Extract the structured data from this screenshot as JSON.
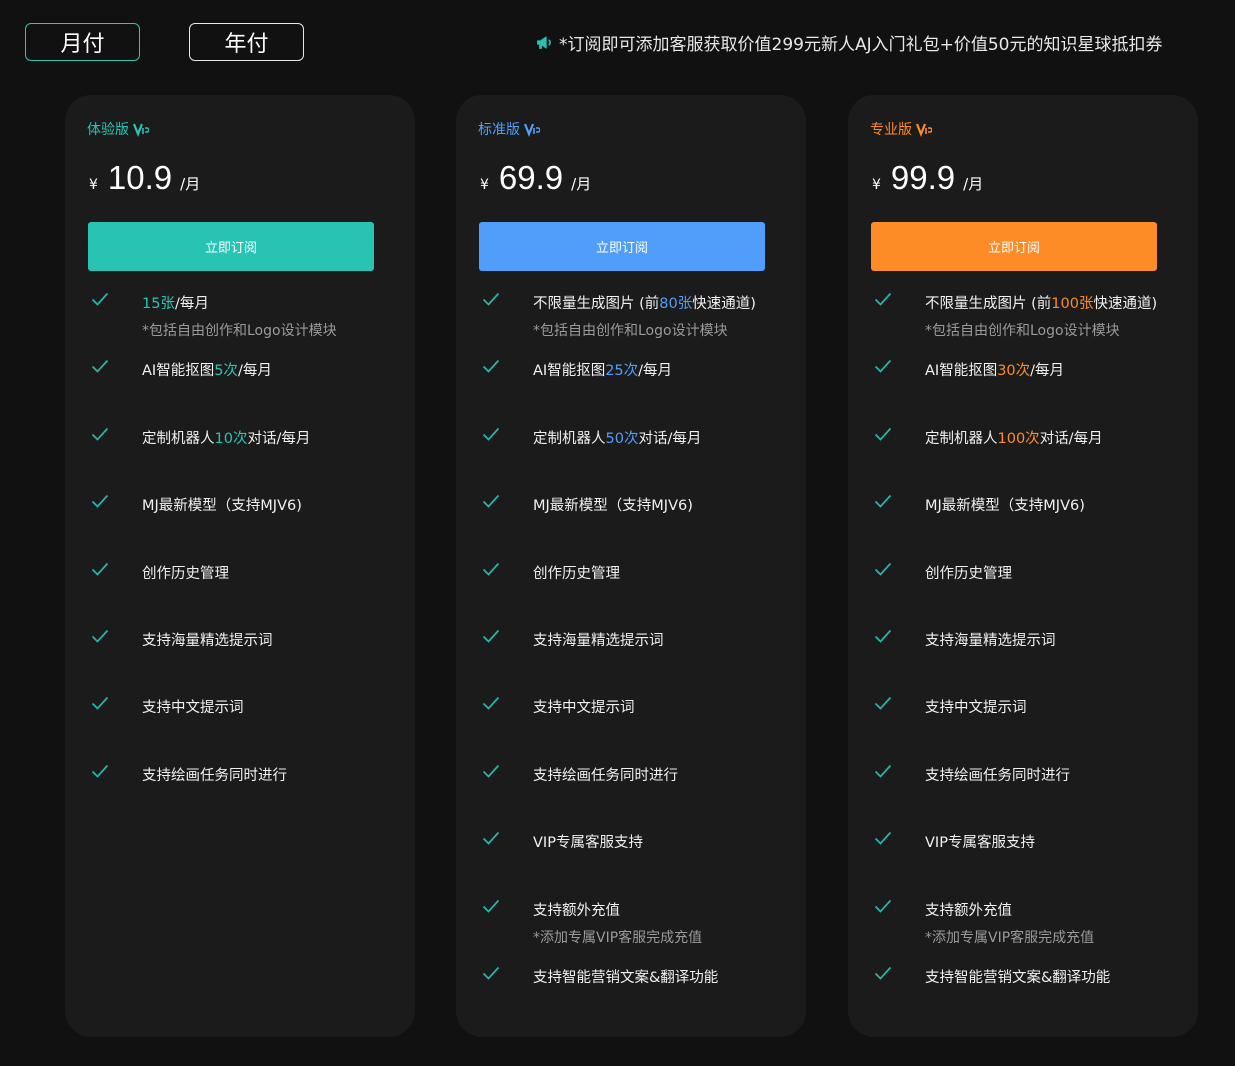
{
  "tabs": {
    "monthly": "月付",
    "yearly": "年付"
  },
  "notice": {
    "icon": "megaphone-icon",
    "text": "*订阅即可添加客服获取价值299元新人AJ入门礼包+价值50元的知识星球抵扣券"
  },
  "colors": {
    "trial": "#28c4b3",
    "standard": "#509ef9",
    "pro": "#fd8b26",
    "check": "#28b4a8"
  },
  "plans": [
    {
      "tier": "体验版",
      "currency": "¥",
      "price": "10.9",
      "per": "/月",
      "button": "立即订阅",
      "features": [
        {
          "pre": "",
          "hl": "15张",
          "post": "/每月",
          "note": "*包括自由创作和Logo设计模块"
        },
        {
          "pre": "AI智能抠图",
          "hl": "5次",
          "post": "/每月"
        },
        {
          "pre": "定制机器人",
          "hl": "10次",
          "post": "对话/每月"
        },
        {
          "pre": "MJ最新模型（支持MJV6)",
          "hl": "",
          "post": ""
        },
        {
          "pre": "创作历史管理",
          "hl": "",
          "post": ""
        },
        {
          "pre": "支持海量精选提示词",
          "hl": "",
          "post": ""
        },
        {
          "pre": "支持中文提示词",
          "hl": "",
          "post": ""
        },
        {
          "pre": "支持绘画任务同时进行",
          "hl": "",
          "post": ""
        }
      ]
    },
    {
      "tier": "标准版",
      "currency": "¥",
      "price": "69.9",
      "per": "/月",
      "button": "立即订阅",
      "features": [
        {
          "pre": "不限量生成图片 (前",
          "hl": "80张",
          "post": "快速通道)",
          "note": "*包括自由创作和Logo设计模块"
        },
        {
          "pre": "AI智能抠图",
          "hl": "25次",
          "post": "/每月"
        },
        {
          "pre": "定制机器人",
          "hl": "50次",
          "post": "对话/每月"
        },
        {
          "pre": "MJ最新模型（支持MJV6)",
          "hl": "",
          "post": ""
        },
        {
          "pre": "创作历史管理",
          "hl": "",
          "post": ""
        },
        {
          "pre": "支持海量精选提示词",
          "hl": "",
          "post": ""
        },
        {
          "pre": "支持中文提示词",
          "hl": "",
          "post": ""
        },
        {
          "pre": "支持绘画任务同时进行",
          "hl": "",
          "post": ""
        },
        {
          "pre": "VIP专属客服支持",
          "hl": "",
          "post": ""
        },
        {
          "pre": "支持额外充值",
          "hl": "",
          "post": "",
          "note": "*添加专属VIP客服完成充值"
        },
        {
          "pre": "支持智能营销文案&翻译功能",
          "hl": "",
          "post": ""
        }
      ]
    },
    {
      "tier": "专业版",
      "currency": "¥",
      "price": "99.9",
      "per": "/月",
      "button": "立即订阅",
      "features": [
        {
          "pre": "不限量生成图片 (前",
          "hl": "100张",
          "post": "快速通道)",
          "note": "*包括自由创作和Logo设计模块"
        },
        {
          "pre": "AI智能抠图",
          "hl": "30次",
          "post": "/每月"
        },
        {
          "pre": "定制机器人",
          "hl": "100次",
          "post": "对话/每月"
        },
        {
          "pre": "MJ最新模型（支持MJV6)",
          "hl": "",
          "post": ""
        },
        {
          "pre": "创作历史管理",
          "hl": "",
          "post": ""
        },
        {
          "pre": "支持海量精选提示词",
          "hl": "",
          "post": ""
        },
        {
          "pre": "支持中文提示词",
          "hl": "",
          "post": ""
        },
        {
          "pre": "支持绘画任务同时进行",
          "hl": "",
          "post": ""
        },
        {
          "pre": "VIP专属客服支持",
          "hl": "",
          "post": ""
        },
        {
          "pre": "支持额外充值",
          "hl": "",
          "post": "",
          "note": "*添加专属VIP客服完成充值"
        },
        {
          "pre": "支持智能营销文案&翻译功能",
          "hl": "",
          "post": ""
        }
      ]
    }
  ]
}
